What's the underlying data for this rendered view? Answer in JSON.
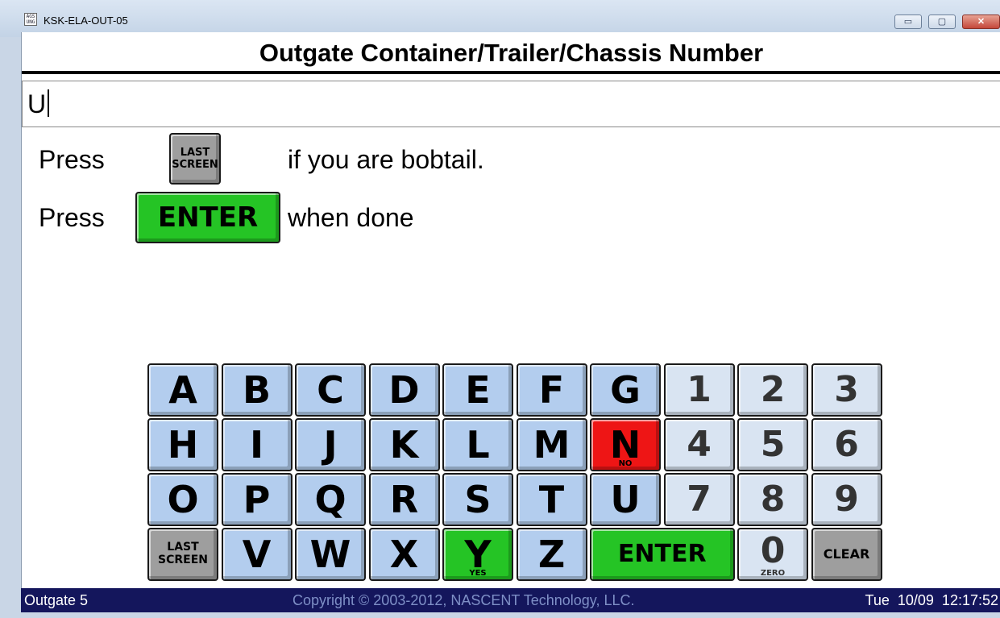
{
  "window": {
    "title": "KSK-ELA-OUT-05",
    "app_icon_text": "AGS\nUNG",
    "minimize_glyph": "▭",
    "maximize_glyph": "▢",
    "close_glyph": "✕"
  },
  "heading": "Outgate Container/Trailer/Chassis Number",
  "input": {
    "value": "U"
  },
  "instructions": {
    "line1_press": "Press",
    "line1_key": "LAST SCREEN",
    "line1_text": "if you are bobtail.",
    "line2_press": "Press",
    "line2_key": "ENTER",
    "line2_text": "when done"
  },
  "keypad": {
    "rows": [
      [
        {
          "label": "A"
        },
        {
          "label": "B"
        },
        {
          "label": "C"
        },
        {
          "label": "D"
        },
        {
          "label": "E"
        },
        {
          "label": "F"
        },
        {
          "label": "G"
        },
        {
          "label": "1"
        },
        {
          "label": "2"
        },
        {
          "label": "3"
        }
      ],
      [
        {
          "label": "H"
        },
        {
          "label": "I"
        },
        {
          "label": "J"
        },
        {
          "label": "K"
        },
        {
          "label": "L"
        },
        {
          "label": "M"
        },
        {
          "label": "N",
          "sub": "NO"
        },
        {
          "label": "4"
        },
        {
          "label": "5"
        },
        {
          "label": "6"
        }
      ],
      [
        {
          "label": "O"
        },
        {
          "label": "P"
        },
        {
          "label": "Q"
        },
        {
          "label": "R"
        },
        {
          "label": "S"
        },
        {
          "label": "T"
        },
        {
          "label": "U"
        },
        {
          "label": "7"
        },
        {
          "label": "8"
        },
        {
          "label": "9"
        }
      ],
      [
        {
          "label": "LAST SCREEN"
        },
        {
          "label": "V"
        },
        {
          "label": "W"
        },
        {
          "label": "X"
        },
        {
          "label": "Y",
          "sub": "YES"
        },
        {
          "label": "Z"
        },
        {
          "label": "ENTER"
        },
        {
          "label": "0",
          "sub": "ZERO"
        },
        {
          "label": "CLEAR"
        }
      ]
    ]
  },
  "colors": {
    "key_blue": "#b3cdee",
    "key_num": "#d9e4f2",
    "key_green": "#25c425",
    "key_red": "#ee1515",
    "key_gray": "#9e9e9e",
    "status_bg": "#14165c"
  },
  "status": {
    "left": "Outgate 5",
    "center": "Copyright © 2003-2012, NASCENT Technology, LLC.",
    "right": "Tue  10/09  12:17:52"
  }
}
